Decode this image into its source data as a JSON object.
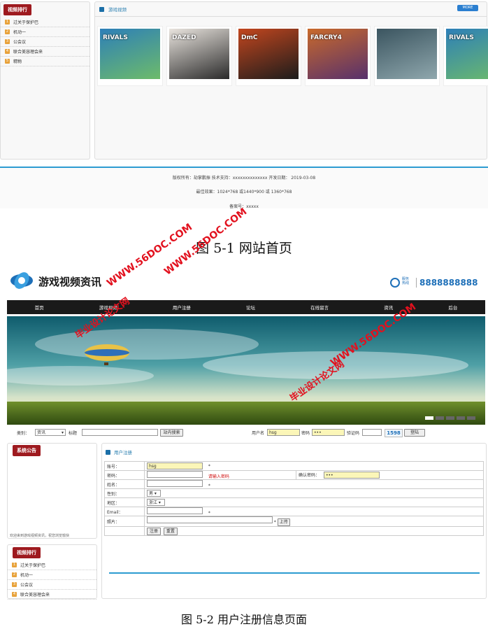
{
  "figure1": {
    "rank_tab": "视频排行",
    "rank_items": [
      "过关于保护巴",
      "机动一",
      "公会议",
      "联合美容理会来",
      "精物"
    ],
    "section_title": "游戏视频",
    "more_button": "MORE",
    "thumbnails": [
      {
        "label": "RIVALS",
        "colors": [
          "#2d7fb8",
          "#6dbb6a"
        ]
      },
      {
        "label": "DAZED",
        "colors": [
          "#e9e4de",
          "#2a2a2a"
        ]
      },
      {
        "label": "DmC",
        "colors": [
          "#c2461e",
          "#1c1c1c"
        ]
      },
      {
        "label": "FARCRY4",
        "colors": [
          "#c96a2b",
          "#57306c"
        ]
      },
      {
        "label": "",
        "colors": [
          "#3b5560",
          "#8fa7ad"
        ]
      },
      {
        "label": "RIVALS",
        "colors": [
          "#2d7fb8",
          "#6dbb6a"
        ]
      }
    ],
    "footer": {
      "line1": "版权所有：劫掌鹏振 技术支持：xxxxxxxxxxxxxx 开发日期： 2019-03-08",
      "line2": "最佳效果：1024*768 或1440*900 或 1360*768",
      "line3": "备案号：xxxxx"
    },
    "caption": "图 5-1  网站首页"
  },
  "figure2": {
    "logo_text": "游戏视频资讯",
    "hotline_label_1": "服务",
    "hotline_label_2": "热线",
    "hotline": "8888888888",
    "nav": [
      "首页",
      "游戏视频",
      "用户注册",
      "论坛",
      "在线留言",
      "资讯",
      "后台"
    ],
    "search": {
      "category_label": "类别：",
      "category_value": "资讯",
      "title_label": "标题",
      "search_button": "站内搜索",
      "username_label": "用户名",
      "username_value": "hsg",
      "password_label": "密码",
      "password_value": "•••",
      "captcha_label": "验证码",
      "captcha_code": "1598",
      "login_button": "登陆"
    },
    "notice_tab": "系统公告",
    "notice_scroll": "欢迎来到游戏视频资讯，祝您浏览愉快",
    "rank_tab": "视频排行",
    "rank_items": [
      "过关于保护巴",
      "机动一",
      "公会议",
      "联合美容理会来"
    ],
    "register_title": "用户注册",
    "form": {
      "account_label": "账号：",
      "account_value": "hsg",
      "required_mark": "*",
      "password_label": "密码：",
      "password_hint": "请输入密码",
      "confirm_label": "确认密码：",
      "confirm_value": "•••",
      "name_label": "姓名：",
      "gender_label": "性别：",
      "gender_value": "男",
      "region_label": "地区：",
      "region_value": "浙江",
      "email_label": "Email：",
      "photo_label": "照片：",
      "upload_button": "上传",
      "register_button": "注册",
      "reset_button": "重置"
    },
    "caption": "图 5-2 用户注册信息页面"
  },
  "watermarks": {
    "site": "WWW.56DOC.COM",
    "cn": "毕业设计论文网"
  },
  "colors": {
    "accent_red": "#9e1a1f",
    "accent_blue": "#2c9bd1",
    "watermark_red": "#e2111e"
  }
}
